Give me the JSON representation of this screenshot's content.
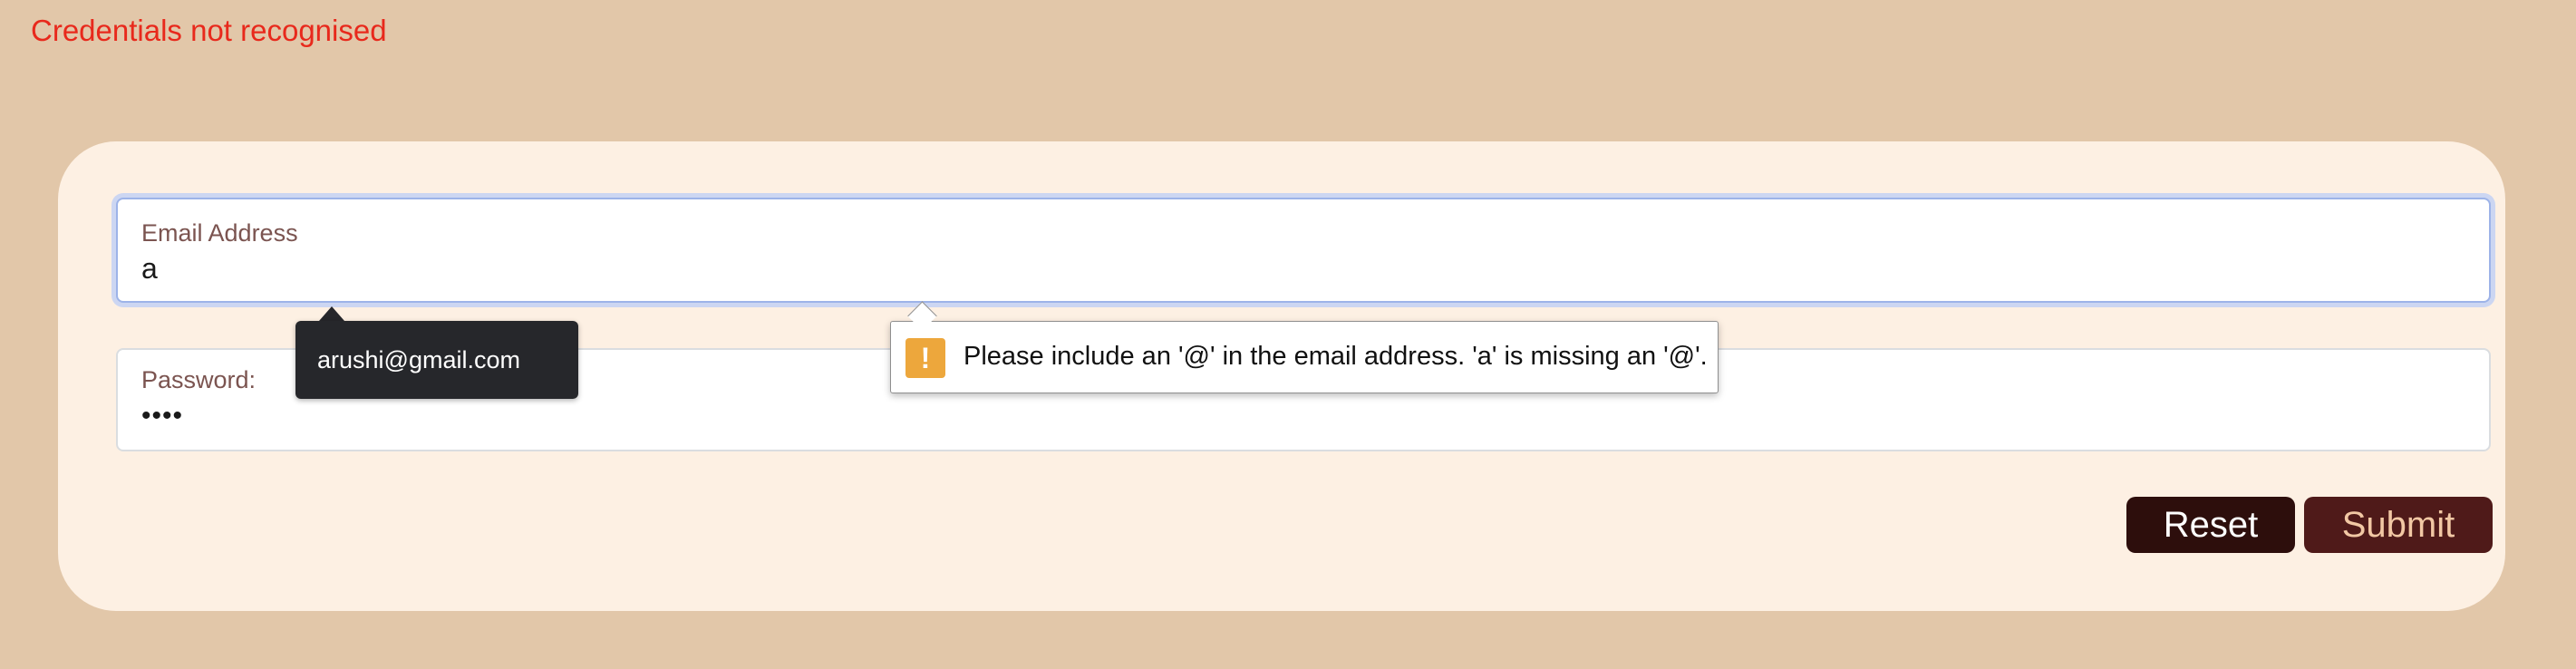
{
  "status": {
    "error_message": "Credentials not recognised",
    "error_color": "#e8291c"
  },
  "form": {
    "email": {
      "label": "Email Address",
      "value": "a"
    },
    "password": {
      "label": "Password:",
      "value": "••••"
    },
    "reset_label": "Reset",
    "submit_label": "Submit"
  },
  "autocomplete": {
    "suggestion": "arushi@gmail.com"
  },
  "validation": {
    "icon": "warning-icon",
    "icon_glyph": "!",
    "message": "Please include an '@' in the email address. 'a' is missing an '@'."
  },
  "colors": {
    "page_background": "#e2c7a9",
    "card_background": "#fdf0e3",
    "reset_button": "#2d0e0c",
    "submit_button": "#4f1a19",
    "focus_ring": "#9db3e8",
    "warning": "#eda73c"
  }
}
